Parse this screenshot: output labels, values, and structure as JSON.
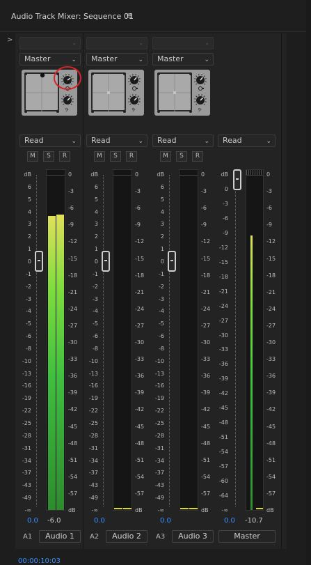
{
  "window": {
    "title": "Audio Track Mixer: Sequence 01",
    "menu_icon": "hamburger-menu-icon",
    "expander_icon": "chevron-right-icon"
  },
  "colors": {
    "accent_blue": "#3a8fff",
    "meter_green": "#3fbf3f",
    "meter_yellow": "#e0e05a",
    "panner_bg": "#9a9a9a",
    "highlight_circle": "#d8232a"
  },
  "meter_scale": {
    "left_db": [
      "dB",
      "6",
      "5",
      "4",
      "3",
      "2",
      "1",
      "0",
      "-1",
      "-2",
      "-3",
      "-4",
      "-5",
      "-6",
      "-8",
      "-10",
      "-13",
      "-16",
      "-19",
      "-22",
      "-25",
      "-28",
      "-31",
      "-34",
      "-37",
      "-43",
      "-49",
      "-∞"
    ],
    "right_db": [
      "0",
      "-3",
      "-6",
      "-9",
      "-12",
      "-15",
      "-18",
      "-21",
      "-24",
      "-27",
      "-30",
      "-33",
      "-36",
      "-39",
      "-42",
      "-45",
      "-48",
      "-51",
      "-54",
      "-57",
      "dB"
    ]
  },
  "master_scale": {
    "left_db": [
      "dB",
      "0",
      "-3",
      "-6",
      "-9",
      "-12",
      "-15",
      "-18",
      "-21",
      "-24",
      "-27",
      "-30",
      "-33",
      "-36",
      "-39",
      "-42",
      "-45",
      "-48",
      "-51",
      "-54",
      "-57",
      "-60",
      "-64",
      "-∞"
    ],
    "right_db": [
      "0",
      "-3",
      "-6",
      "-9",
      "-12",
      "-15",
      "-18",
      "-21",
      "-24",
      "-27",
      "-30",
      "-33",
      "-36",
      "-39",
      "-42",
      "-45",
      "-48",
      "-51",
      "-54",
      "-57",
      "dB"
    ]
  },
  "channels": [
    {
      "id": "A1",
      "name": "Audio 1",
      "output": "Master",
      "automation": "Read",
      "m": "M",
      "s": "S",
      "r": "R",
      "volume": "0.0",
      "peak": "-6.0",
      "level_fraction": 0.88,
      "has_annotation": true
    },
    {
      "id": "A2",
      "name": "Audio 2",
      "output": "Master",
      "automation": "Read",
      "m": "M",
      "s": "S",
      "r": "R",
      "volume": "0.0",
      "peak": "",
      "level_fraction": 0.0,
      "has_annotation": false
    },
    {
      "id": "A3",
      "name": "Audio 3",
      "output": "Master",
      "automation": "Read",
      "m": "M",
      "s": "S",
      "r": "R",
      "volume": "0.0",
      "peak": "",
      "level_fraction": 0.0,
      "has_annotation": false
    }
  ],
  "master": {
    "name": "Master",
    "automation": "Read",
    "volume": "0.0",
    "peak": "-10.7",
    "level_fraction": 0.83
  },
  "timecode": "00:00:10:03"
}
